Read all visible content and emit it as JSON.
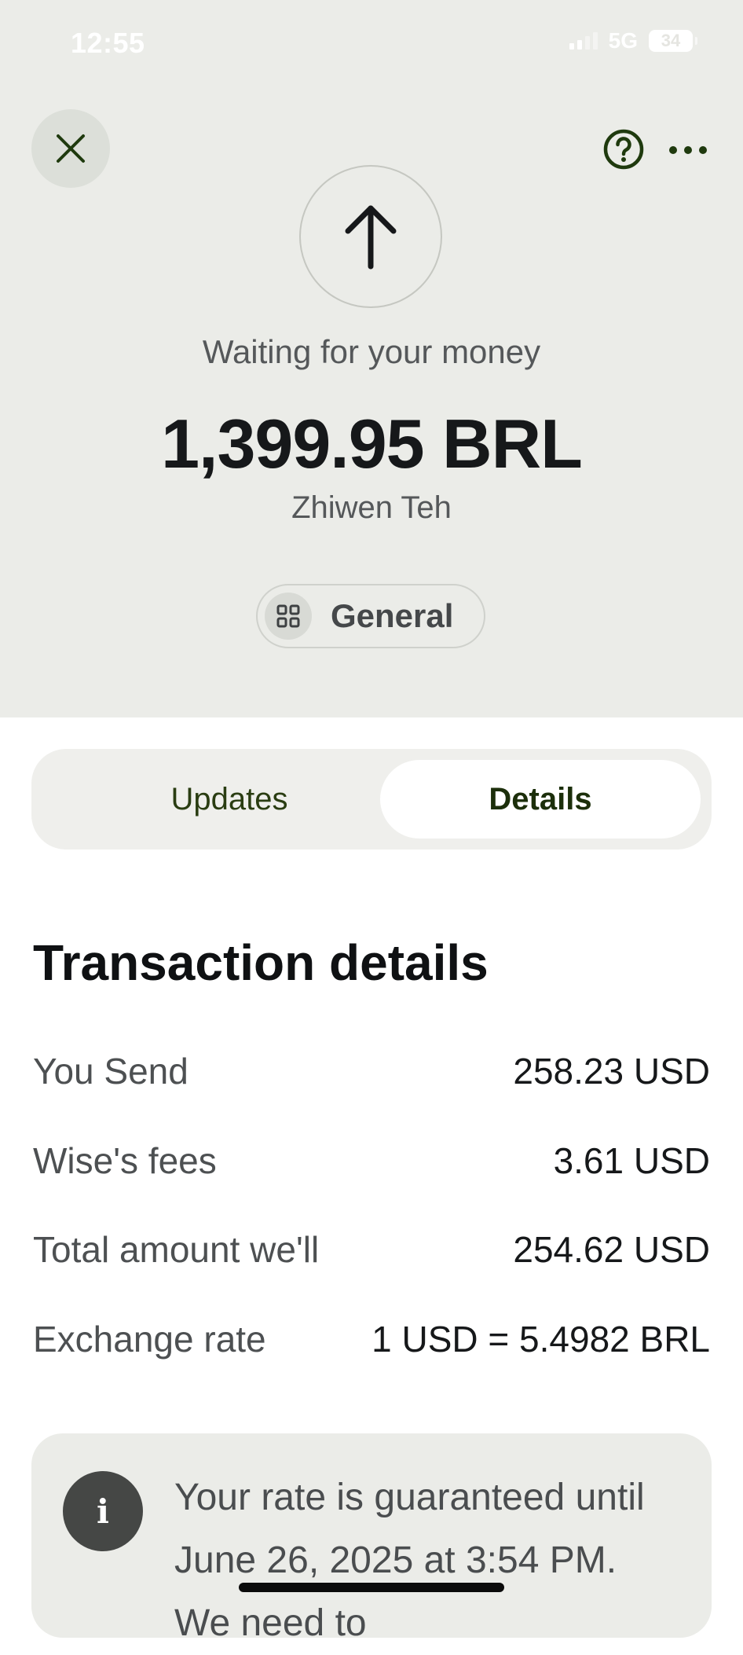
{
  "status_bar": {
    "time": "12:55",
    "network": "5G",
    "battery": "34"
  },
  "header": {
    "close_icon": "close-icon",
    "help_icon": "help-circle-icon",
    "more_icon": "more-horizontal-icon"
  },
  "transfer": {
    "status_icon": "arrow-up-icon",
    "status_text": "Waiting for your money",
    "amount": "1,399.95 BRL",
    "recipient": "Zhiwen Teh",
    "category_icon": "grid-icon",
    "category": "General"
  },
  "tabs": [
    {
      "label": "Updates",
      "active": false
    },
    {
      "label": "Details",
      "active": true
    }
  ],
  "details": {
    "title": "Transaction details",
    "rows": [
      {
        "label": "You Send",
        "value": "258.23 USD"
      },
      {
        "label": "Wise's fees",
        "value": "3.61 USD"
      },
      {
        "label": "Total amount we'll",
        "value": "254.62 USD"
      },
      {
        "label": "Exchange rate",
        "value": "1 USD = 5.4982 BRL"
      }
    ]
  },
  "info": {
    "icon": "info-icon",
    "text": "Your rate is guaranteed until June 26, 2025 at 3:54 PM. We need to"
  },
  "colors": {
    "top_background": "#ebece8",
    "accent_dark_green": "#1c2f0b",
    "text_primary": "#16181a",
    "text_secondary": "#55585a"
  }
}
